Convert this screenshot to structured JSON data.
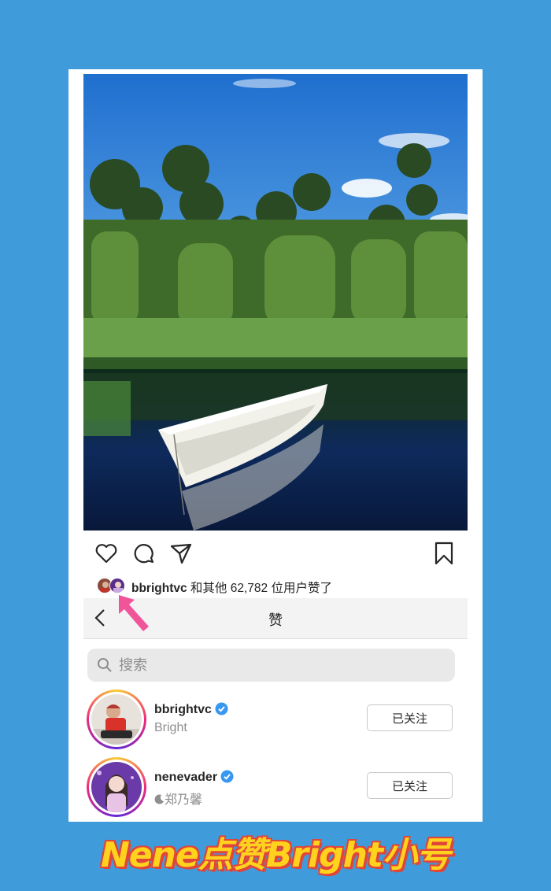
{
  "post": {
    "image_alt": "white boat on pond with tall grass",
    "actions": {
      "like_icon": "heart-icon",
      "comment_icon": "comment-icon",
      "share_icon": "send-icon",
      "save_icon": "bookmark-icon"
    },
    "likes_user": "bbrightvc",
    "likes_rest": " 和其他 62,782 位用户赞了"
  },
  "likes_page": {
    "title": "赞",
    "back_icon": "chevron-left-icon",
    "search_placeholder": "搜索",
    "users": [
      {
        "username": "bbrightvc",
        "display_name": "Bright",
        "verified": true,
        "follow_label": "已关注"
      },
      {
        "username": "nenevader",
        "display_name": "郑乃馨",
        "name_prefix_icon": "moon-icon",
        "verified": true,
        "follow_label": "已关注"
      }
    ]
  },
  "caption": "Nene点赞Bright小号",
  "colors": {
    "background": "#3f9bd9",
    "arrow": "#f0559a",
    "verified": "#3897f0",
    "caption_fill": "#ffd21e",
    "caption_outline": "#e0453a"
  }
}
